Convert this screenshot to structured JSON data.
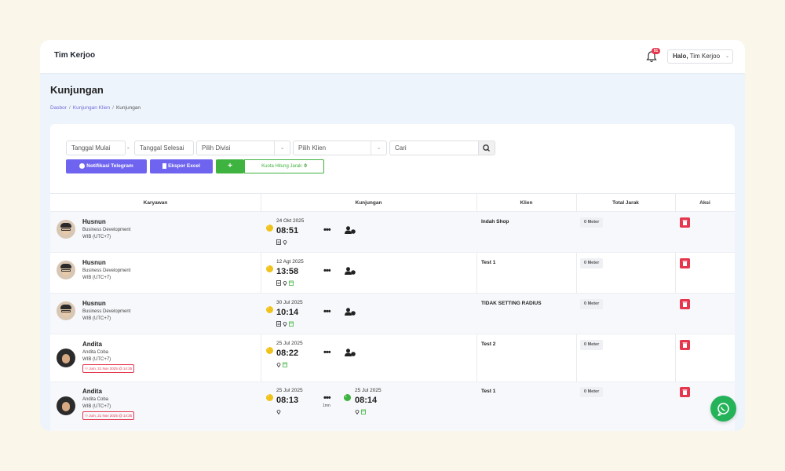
{
  "topbar": {
    "brand": "Tim Kerjoo",
    "notification_count": "91",
    "greeting": "Halo,",
    "user_name": "Tim Kerjoo"
  },
  "page": {
    "title": "Kunjungan",
    "breadcrumb": [
      "Dasbor",
      "Kunjungan Klien",
      "Kunjungan"
    ]
  },
  "filters": {
    "start_date": "Tanggal Mulai",
    "end_date": "Tanggal Selesai",
    "division": "Pilih Divisi",
    "client": "Pilih Klien",
    "search": "Cari",
    "separator": "-"
  },
  "actions": {
    "telegram": "Notifikasi Telegram",
    "excel": "Ekspor Excel",
    "add": "+",
    "quota_label": "Kuota Hitung Jarak:",
    "quota_value": "0"
  },
  "table": {
    "headers": [
      "Karyawan",
      "Kunjungan",
      "Klien",
      "Total Jarak",
      "Aksi"
    ],
    "rows": [
      {
        "name": "Husnun",
        "division": "Business Development",
        "tz": "WIB (UTC+7)",
        "badge": "",
        "in_date": "24 Okt 2025",
        "in_time": "08:51",
        "out_date": "",
        "out_time": "",
        "duration": "",
        "client": "Indah Shop",
        "distance": "0 Meter"
      },
      {
        "name": "Husnun",
        "division": "Business Development",
        "tz": "WIB (UTC+7)",
        "badge": "",
        "in_date": "12 Agt 2025",
        "in_time": "13:58",
        "out_date": "",
        "out_time": "",
        "duration": "",
        "client": "Test 1",
        "distance": "0 Meter"
      },
      {
        "name": "Husnun",
        "division": "Business Development",
        "tz": "WIB (UTC+7)",
        "badge": "",
        "in_date": "30 Jul 2025",
        "in_time": "10:14",
        "out_date": "",
        "out_time": "",
        "duration": "",
        "client": "TIDAK SETTING RADIUS",
        "distance": "0 Meter"
      },
      {
        "name": "Andita",
        "division": "Andita Coba",
        "tz": "WIB (UTC+7)",
        "badge": "Jum, 21 Nov 2025 @ 14:35",
        "in_date": "25 Jul 2025",
        "in_time": "08:22",
        "out_date": "",
        "out_time": "",
        "duration": "",
        "client": "Test 2",
        "distance": "0 Meter"
      },
      {
        "name": "Andita",
        "division": "Andita Coba",
        "tz": "WIB (UTC+7)",
        "badge": "Jum, 21 Nov 2025 @ 14:35",
        "in_date": "25 Jul 2025",
        "in_time": "08:13",
        "out_date": "25 Jul 2025",
        "out_time": "08:14",
        "duration": "1mn",
        "client": "Test 1",
        "distance": "0 Meter"
      }
    ]
  },
  "icons": {
    "bell": "bell-icon",
    "search": "search-icon",
    "whatsapp": "whatsapp-icon",
    "delete": "trash-icon"
  },
  "colors": {
    "primary": "#6f64ef",
    "success": "#3fb33f",
    "danger": "#e5364d",
    "warning": "#f1c21b"
  }
}
